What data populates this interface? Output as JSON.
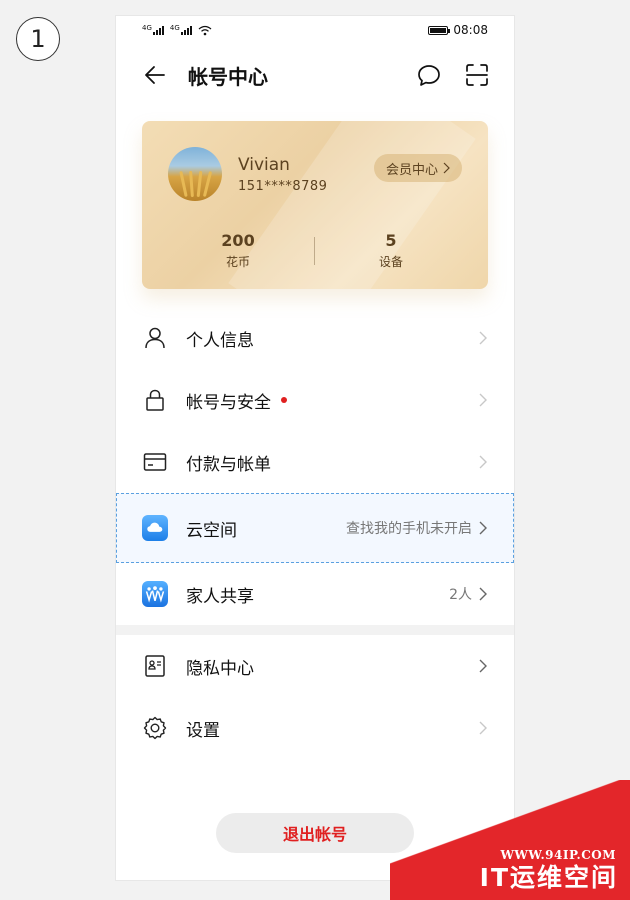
{
  "step": "1",
  "status_bar": {
    "signal_prefix": "4G",
    "time": "08:08"
  },
  "header": {
    "title": "帐号中心",
    "icons": [
      "back-arrow-icon",
      "message-icon",
      "scan-icon"
    ]
  },
  "profile": {
    "name": "Vivian",
    "phone": "151****8789",
    "member_label": "会员中心",
    "stats": [
      {
        "value": "200",
        "label": "花币"
      },
      {
        "value": "5",
        "label": "设备"
      }
    ],
    "colors": {
      "card": "#ecd1a4",
      "text": "#5c4220"
    }
  },
  "menu": {
    "items": [
      {
        "label": "个人信息",
        "icon": "person-icon"
      },
      {
        "label": "帐号与安全",
        "icon": "lock-icon",
        "badge": "red-dot"
      },
      {
        "label": "付款与帐单",
        "icon": "card-icon"
      },
      {
        "label": "云空间",
        "icon": "cloud-app-icon",
        "extra": "查找我的手机未开启",
        "highlighted": true
      },
      {
        "label": "家人共享",
        "icon": "family-app-icon",
        "extra": "2人"
      }
    ],
    "items2": [
      {
        "label": "隐私中心",
        "icon": "privacy-icon"
      },
      {
        "label": "设置",
        "icon": "gear-icon"
      }
    ]
  },
  "logout_label": "退出帐号",
  "watermark": {
    "url": "WWW.94IP.COM",
    "title": "IT运维空间"
  },
  "colors": {
    "accent_red": "#e02020",
    "highlight_border": "#5aa0e0",
    "highlight_bg": "#f3f8ff"
  }
}
